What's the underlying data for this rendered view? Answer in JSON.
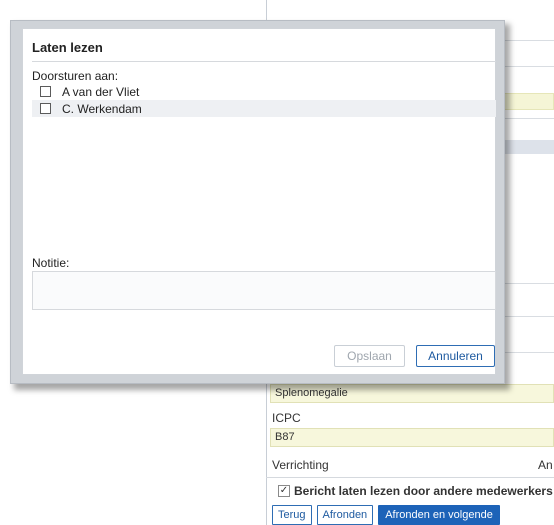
{
  "dialog": {
    "title": "Laten lezen",
    "forward_label": "Doorsturen aan:",
    "recipients": [
      {
        "name": "A van der Vliet",
        "checked": false
      },
      {
        "name": "C. Werkendam",
        "checked": false
      }
    ],
    "note_label": "Notitie:",
    "note_value": "",
    "save_label": "Opslaan",
    "save_enabled": false,
    "cancel_label": "Annuleren"
  },
  "background": {
    "diagnosis_value": "Splenomegalie",
    "icpc_label": "ICPC",
    "icpc_value": "B87",
    "verrichting_label": "Verrichting",
    "verrichting_right_fragment": "An",
    "share_checkbox_label": "Bericht laten lezen door andere medewerkers",
    "share_checkbox_checked": true,
    "share_checkbox_glyph": "✓",
    "buttons": {
      "back": "Terug",
      "finish": "Afronden",
      "finish_next": "Afronden en volgende"
    }
  },
  "colors": {
    "accent": "#1d63b8",
    "field_yellow": "#f7f7dc",
    "disabled_text": "#9fa6ae"
  }
}
